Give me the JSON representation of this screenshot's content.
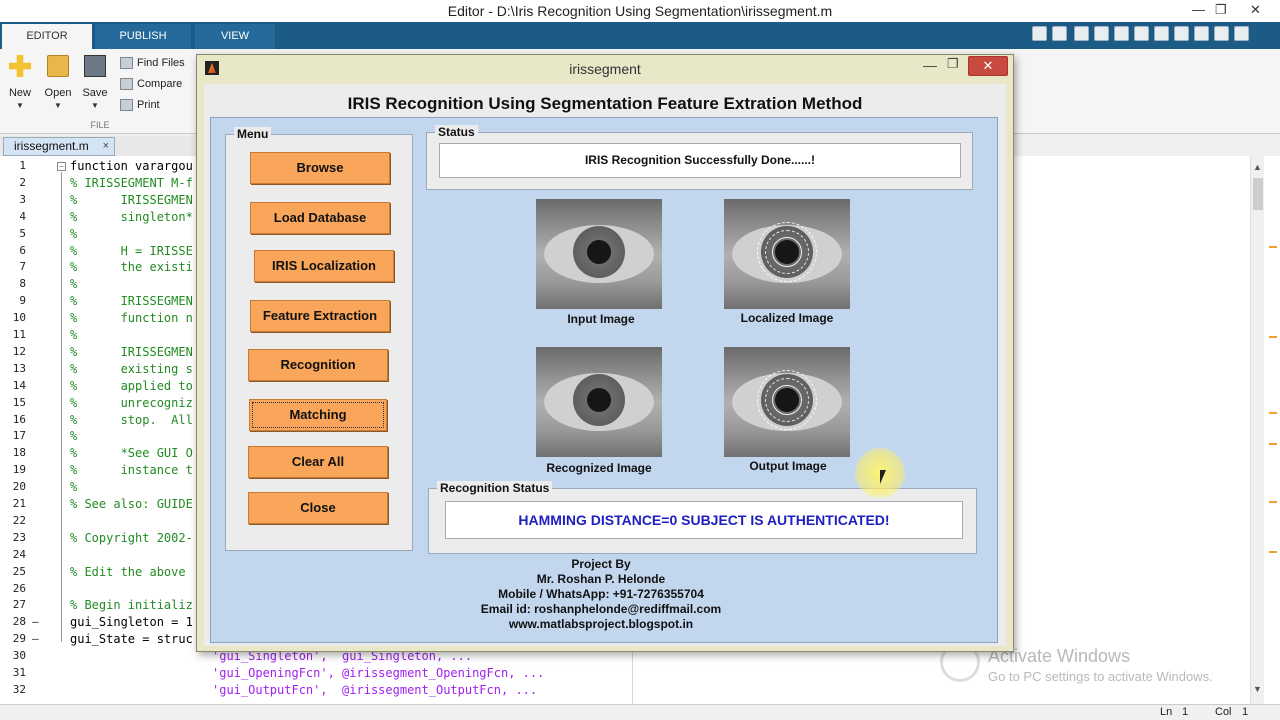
{
  "window": {
    "title": "Editor - D:\\Iris Recognition Using Segmentation\\irissegment.m",
    "minimize": "—",
    "maximize": "❐",
    "close": "✕"
  },
  "ribbon": {
    "tabs": [
      "EDITOR",
      "PUBLISH",
      "VIEW"
    ],
    "new_label": "New",
    "open_label": "Open",
    "save_label": "Save",
    "find_files_label": "Find Files",
    "compare_label": "Compare",
    "print_label": "Print",
    "group_label": "FILE"
  },
  "file_tab": {
    "name": "irissegment.m",
    "close": "×"
  },
  "code_lines": [
    {
      "n": "1",
      "text": "function varargou"
    },
    {
      "n": "2",
      "text": "% IRISSEGMENT M-f"
    },
    {
      "n": "3",
      "text": "%      IRISSEGMEN"
    },
    {
      "n": "4",
      "text": "%      singleton*"
    },
    {
      "n": "5",
      "text": "%"
    },
    {
      "n": "6",
      "text": "%      H = IRISSE"
    },
    {
      "n": "7",
      "text": "%      the existi"
    },
    {
      "n": "8",
      "text": "%"
    },
    {
      "n": "9",
      "text": "%      IRISSEGMEN"
    },
    {
      "n": "10",
      "text": "%      function n"
    },
    {
      "n": "11",
      "text": "%"
    },
    {
      "n": "12",
      "text": "%      IRISSEGMEN"
    },
    {
      "n": "13",
      "text": "%      existing s"
    },
    {
      "n": "14",
      "text": "%      applied to"
    },
    {
      "n": "15",
      "text": "%      unrecogniz"
    },
    {
      "n": "16",
      "text": "%      stop.  All"
    },
    {
      "n": "17",
      "text": "%"
    },
    {
      "n": "18",
      "text": "%      *See GUI O"
    },
    {
      "n": "19",
      "text": "%      instance t"
    },
    {
      "n": "20",
      "text": "%"
    },
    {
      "n": "21",
      "text": "% See also: GUIDE"
    },
    {
      "n": "22",
      "text": ""
    },
    {
      "n": "23",
      "text": "% Copyright 2002-"
    },
    {
      "n": "24",
      "text": ""
    },
    {
      "n": "25",
      "text": "% Edit the above"
    },
    {
      "n": "26",
      "text": ""
    },
    {
      "n": "27",
      "text": "% Begin initializ"
    },
    {
      "n": "28",
      "text": "gui_Singleton = 1"
    },
    {
      "n": "29",
      "text": "gui_State = struc"
    },
    {
      "n": "30",
      "text": "'gui_Singleton',  gui_Singleton, ..."
    },
    {
      "n": "31",
      "text": "'gui_OpeningFcn', @irissegment_OpeningFcn, ..."
    },
    {
      "n": "32",
      "text": "'gui_OutputFcn',  @irissegment_OutputFcn, ..."
    }
  ],
  "status_bar": {
    "ln_label": "Ln",
    "ln_value": "1",
    "col_label": "Col",
    "col_value": "1"
  },
  "watermark": {
    "line1": "Activate Windows",
    "line2": "Go to PC settings to activate Windows."
  },
  "gui": {
    "window_title": "irissegment",
    "heading": "IRIS Recognition Using Segmentation Feature Extration Method",
    "menu_legend": "Menu",
    "buttons": {
      "browse": "Browse",
      "load_database": "Load Database",
      "iris_localization": "IRIS Localization",
      "feature_extraction": "Feature Extraction",
      "recognition": "Recognition",
      "matching": "Matching",
      "clear_all": "Clear All",
      "close": "Close"
    },
    "status_legend": "Status",
    "status_text": "IRIS Recognition Successfully Done......!",
    "images": {
      "input": "Input Image",
      "localized": "Localized Image",
      "recognized": "Recognized Image",
      "output": "Output Image"
    },
    "recognition_legend": "Recognition  Status",
    "recognition_text": "HAMMING DISTANCE=0 SUBJECT IS AUTHENTICATED!",
    "credits": {
      "line1": "Project By",
      "line2": "Mr. Roshan P. Helonde",
      "line3": "Mobile / WhatsApp: +91-7276355704",
      "line4": "Email id: roshanphelonde@rediffmail.com",
      "line5": "www.matlabsproject.blogspot.in"
    }
  },
  "colors": {
    "button_orange": "#f9a55a",
    "figure_blue": "#c2d6ee",
    "ribbon_blue": "#1b5b86",
    "recognition_text": "#1e1ec0"
  }
}
